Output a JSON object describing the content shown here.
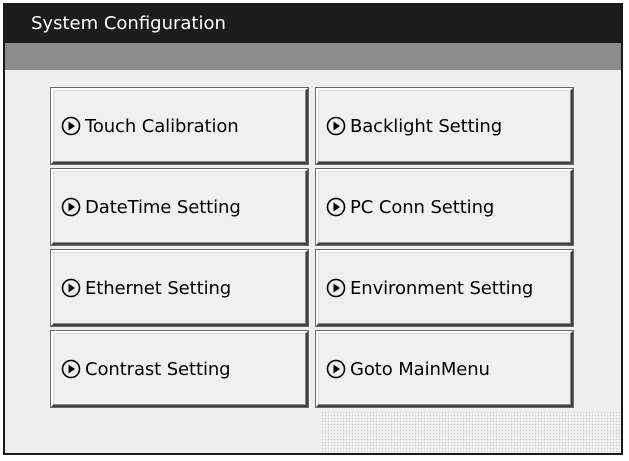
{
  "window": {
    "title": "System Configuration"
  },
  "menu": {
    "items": [
      {
        "label": "Touch Calibration",
        "icon": "play-circle-icon"
      },
      {
        "label": "Backlight Setting",
        "icon": "play-circle-icon"
      },
      {
        "label": "DateTime Setting",
        "icon": "play-circle-icon"
      },
      {
        "label": "PC Conn Setting",
        "icon": "play-circle-icon"
      },
      {
        "label": "Ethernet Setting",
        "icon": "play-circle-icon"
      },
      {
        "label": "Environment Setting",
        "icon": "play-circle-icon"
      },
      {
        "label": "Contrast Setting",
        "icon": "play-circle-icon"
      },
      {
        "label": "Goto MainMenu",
        "icon": "play-circle-icon"
      }
    ]
  },
  "colors": {
    "title_bar": "#1c1c1c",
    "sub_bar": "#8c8c8c",
    "background": "#efefef",
    "button_face": "#f0f0f0"
  }
}
